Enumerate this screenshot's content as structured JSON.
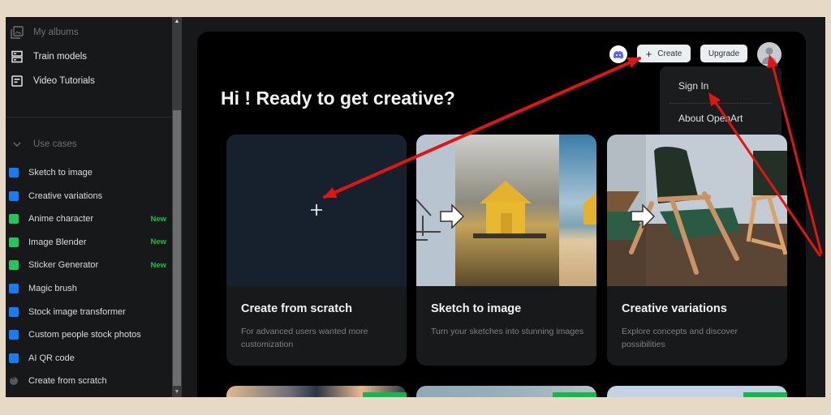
{
  "sidebar": {
    "nav": [
      {
        "label": "My albums",
        "icon": "album-icon",
        "dim": true
      },
      {
        "label": "Train models",
        "icon": "train-models-icon",
        "dim": false
      },
      {
        "label": "Video Tutorials",
        "icon": "video-tutorials-icon",
        "dim": false
      }
    ],
    "use_cases_header": "Use cases",
    "use_cases": [
      {
        "label": "Sketch to image",
        "color": "#1a7cf2",
        "badge": ""
      },
      {
        "label": "Creative variations",
        "color": "#1a7cf2",
        "badge": ""
      },
      {
        "label": "Anime character",
        "color": "#22c55e",
        "badge": "New"
      },
      {
        "label": "Image Blender",
        "color": "#22c55e",
        "badge": "New"
      },
      {
        "label": "Sticker Generator",
        "color": "#22c55e",
        "badge": "New"
      },
      {
        "label": "Magic brush",
        "color": "#1a7cf2",
        "badge": ""
      },
      {
        "label": "Stock image transformer",
        "color": "#1a7cf2",
        "badge": ""
      },
      {
        "label": "Custom people stock photos",
        "color": "#1a7cf2",
        "badge": ""
      },
      {
        "label": "AI QR code",
        "color": "#1a7cf2",
        "badge": ""
      },
      {
        "label": "Create from scratch",
        "color": "",
        "badge": ""
      }
    ]
  },
  "header": {
    "create_label": "Create",
    "upgrade_label": "Upgrade"
  },
  "account_menu": {
    "items": [
      "Sign In",
      "About OpenArt"
    ]
  },
  "main": {
    "title": "Hi ! Ready to get creative?",
    "cards": [
      {
        "title": "Create from scratch",
        "description": "For advanced users wanted more customization"
      },
      {
        "title": "Sketch to image",
        "description": "Turn your sketches into stunning images"
      },
      {
        "title": "Creative variations",
        "description": "Explore concepts and discover possibilities"
      }
    ]
  },
  "annotation": {
    "arrow_color": "#e01515"
  }
}
